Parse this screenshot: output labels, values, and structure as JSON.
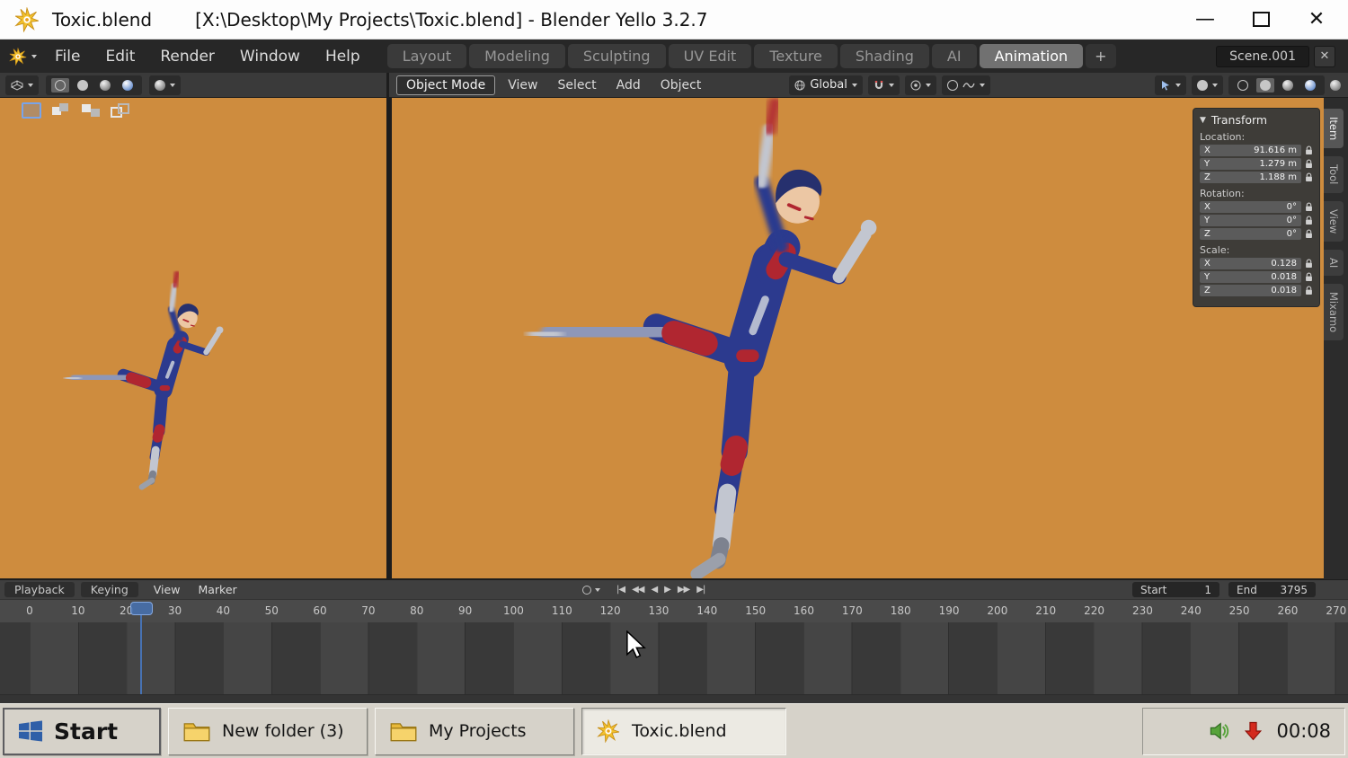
{
  "titlebar": {
    "app_name": "Toxic.blend",
    "window_title": "[X:\\Desktop\\My Projects\\Toxic.blend] - Blender Yello 3.2.7",
    "minimize_glyph": "—",
    "close_glyph": "✕"
  },
  "menubar": {
    "menus": [
      "File",
      "Edit",
      "Render",
      "Window",
      "Help"
    ],
    "workspace_tabs": [
      "Layout",
      "Modeling",
      "Sculpting",
      "UV Edit",
      "Texture",
      "Shading",
      "AI",
      "Animation"
    ],
    "active_workspace": "Animation",
    "add_tab": "+",
    "scene_name": "Scene.001",
    "scene_close_glyph": "✕"
  },
  "viewport_header": {
    "mode": "Object Mode",
    "menus": [
      "View",
      "Select",
      "Add",
      "Object"
    ],
    "orientation": "Global"
  },
  "sidebar": {
    "tabs": [
      "Item",
      "Tool",
      "View",
      "AI",
      "Mixamo"
    ],
    "active_tab": "Item"
  },
  "transform": {
    "title": "Transform",
    "collapse_glyph": "▼",
    "axis": {
      "x": "X",
      "y": "Y",
      "z": "Z"
    },
    "location_label": "Location:",
    "location": {
      "x": "91.616 m",
      "y": "1.279 m",
      "z": "1.188 m"
    },
    "rotation_label": "Rotation:",
    "rotation": {
      "x": "0°",
      "y": "0°",
      "z": "0°"
    },
    "scale_label": "Scale:",
    "scale": {
      "x": "0.128",
      "y": "0.018",
      "z": "0.018"
    }
  },
  "timeline": {
    "menus": [
      "Playback",
      "Keying",
      "View",
      "Marker"
    ],
    "transport": [
      "|◀",
      "◀◀",
      "◀",
      "▶",
      "▶▶",
      "▶|"
    ],
    "start_label": "Start",
    "start_value": "1",
    "end_label": "End",
    "end_value": "3795",
    "current_frame": 23,
    "ticks": [
      "0",
      "10",
      "20",
      "30",
      "40",
      "50",
      "60",
      "70",
      "80",
      "90",
      "100",
      "110",
      "120",
      "130",
      "140",
      "150",
      "160",
      "170",
      "180",
      "190",
      "200",
      "210",
      "220",
      "230",
      "240",
      "250",
      "260",
      "270"
    ]
  },
  "taskbar": {
    "start_label": "Start",
    "buttons": [
      {
        "label": "New folder (3)"
      },
      {
        "label": "My Projects"
      },
      {
        "label": "Toxic.blend"
      }
    ],
    "clock": "00:08"
  }
}
